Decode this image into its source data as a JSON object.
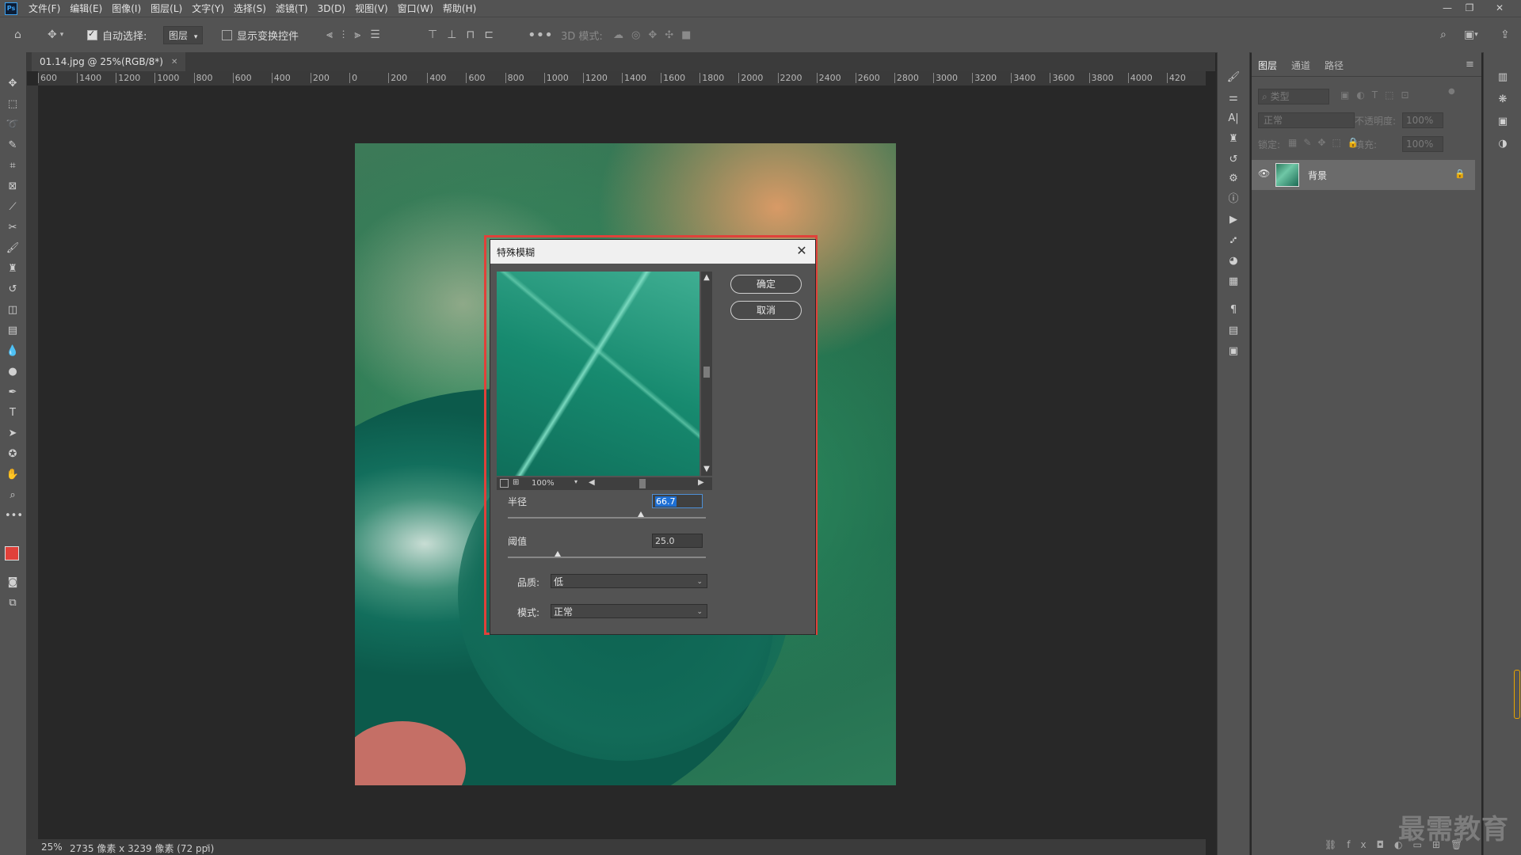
{
  "app": {
    "logo": "Ps"
  },
  "menu": [
    "文件(F)",
    "编辑(E)",
    "图像(I)",
    "图层(L)",
    "文字(Y)",
    "选择(S)",
    "滤镜(T)",
    "3D(D)",
    "视图(V)",
    "窗口(W)",
    "帮助(H)"
  ],
  "options": {
    "auto_select_label": "自动选择:",
    "auto_select_value": "图层",
    "show_transform_label": "显示变换控件",
    "mode_3d_label": "3D 模式:"
  },
  "document": {
    "tab_title": "01.14.jpg @ 25%(RGB/8*)",
    "zoom": "25%",
    "size_info": "2735 像素 x 3239 像素 (72 ppi)"
  },
  "ruler_ticks": [
    "600",
    "1400",
    "1200",
    "1000",
    "800",
    "600",
    "400",
    "200",
    "0",
    "200",
    "400",
    "600",
    "800",
    "1000",
    "1200",
    "1400",
    "1600",
    "1800",
    "2000",
    "2200",
    "2400",
    "2600",
    "2800",
    "3000",
    "3200",
    "3400",
    "3600",
    "3800",
    "4000",
    "420"
  ],
  "dialog": {
    "title": "特殊模糊",
    "ok": "确定",
    "cancel": "取消",
    "preview_zoom": "100%",
    "radius_label": "半径",
    "radius_value": "66.7",
    "radius_pct": 0.67,
    "threshold_label": "阈值",
    "threshold_value": "25.0",
    "threshold_pct": 0.25,
    "quality_label": "品质:",
    "quality_value": "低",
    "mode_label": "模式:",
    "mode_value": "正常"
  },
  "layers_panel": {
    "tabs": [
      "图层",
      "通道",
      "路径"
    ],
    "filter_placeholder": "类型",
    "blend_mode": "正常",
    "opacity_label": "不透明度:",
    "opacity_value": "100%",
    "lock_label": "锁定:",
    "fill_label": "填充:",
    "fill_value": "100%",
    "layers": [
      {
        "name": "背景",
        "locked": true,
        "visible": true
      }
    ]
  },
  "watermark": "最需教育",
  "colors": {
    "foreground": "#e0413a",
    "background": "#ffffff",
    "highlight": "#e0413a"
  }
}
